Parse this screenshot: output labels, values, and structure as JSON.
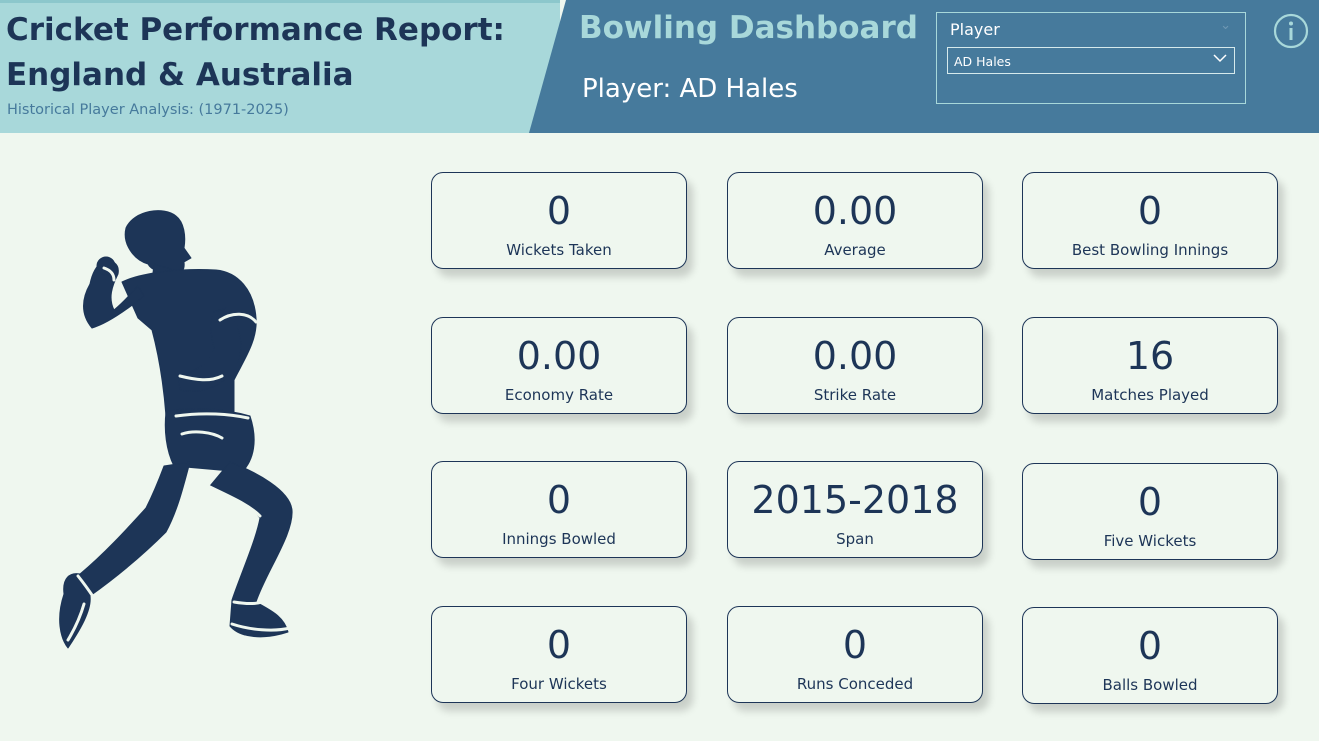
{
  "header": {
    "title": "Cricket Performance Report: England & Australia",
    "subtitle": "Historical Player Analysis: (1971-2025)",
    "dashboard_title": "Bowling Dashboard",
    "player_line": "Player: AD Hales"
  },
  "slicer": {
    "label": "Player",
    "selected_value": "AD Hales"
  },
  "icons": {
    "info": "info-icon",
    "figure": "cricket-bowler-icon"
  },
  "colors": {
    "navy": "#1d3557",
    "teal_light": "#a8d8da",
    "steel_blue": "#467a9c",
    "background": "#eff7ef"
  },
  "cards": [
    {
      "value": "0",
      "label": "Wickets Taken"
    },
    {
      "value": "0.00",
      "label": "Average"
    },
    {
      "value": "0",
      "label": "Best Bowling Innings"
    },
    {
      "value": "0.00",
      "label": "Economy Rate"
    },
    {
      "value": "0.00",
      "label": "Strike Rate"
    },
    {
      "value": "16",
      "label": "Matches Played"
    },
    {
      "value": "0",
      "label": "Innings Bowled"
    },
    {
      "value": "2015-2018",
      "label": "Span"
    },
    {
      "value": "0",
      "label": "Five Wickets"
    },
    {
      "value": "0",
      "label": "Four Wickets"
    },
    {
      "value": "0",
      "label": "Runs Conceded"
    },
    {
      "value": "0",
      "label": "Balls Bowled"
    }
  ]
}
